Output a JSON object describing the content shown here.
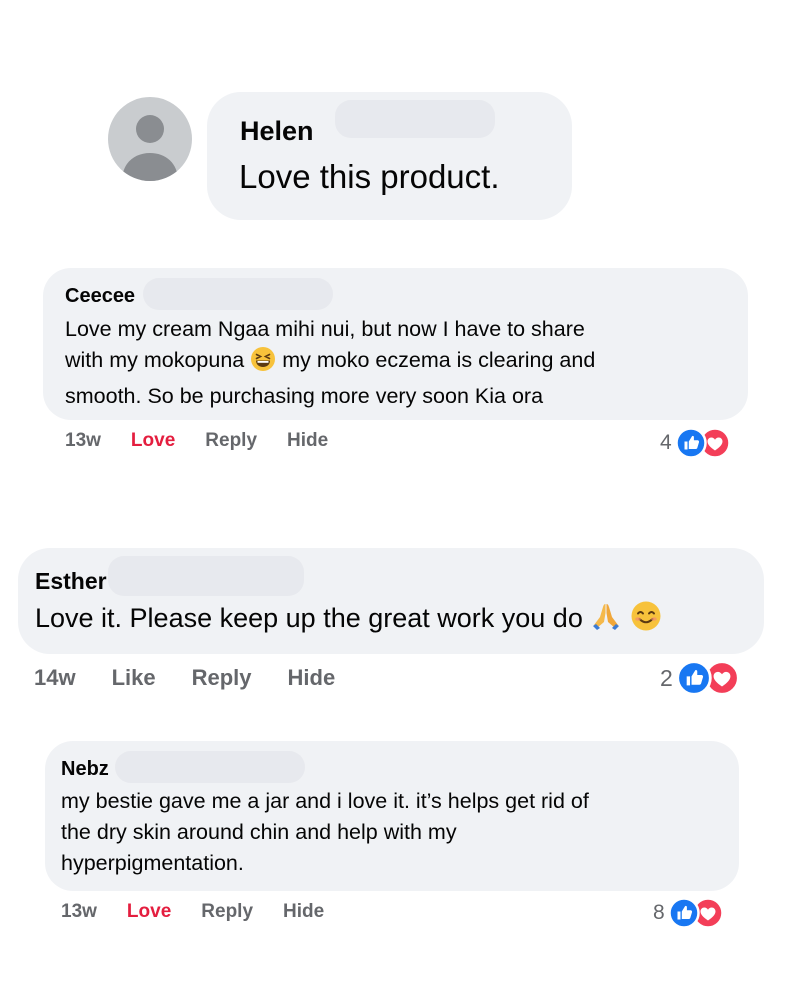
{
  "colors": {
    "bubble": "#f0f2f5",
    "love_action": "#e41e3f",
    "like_badge": "#1877f2",
    "heart_badge": "#f33e58",
    "meta_text": "#65676b"
  },
  "comments": [
    {
      "author": "Helen",
      "text": "Love this product.",
      "avatar": "default-avatar-icon"
    },
    {
      "author": "Ceecee",
      "text_lines": [
        "Love my cream Ngaa mihi nui, but now I have to share",
        "with my mokopuna",
        "my moko eczema is clearing and",
        "smooth. So be purchasing more very soon Kia ora"
      ],
      "emoji": "grinning-squinting-face-emoji",
      "time": "13w",
      "action_primary": "Love",
      "reply": "Reply",
      "hide": "Hide",
      "reaction_count": "4",
      "reactions": [
        "like-icon",
        "heart-icon"
      ]
    },
    {
      "author": "Esther",
      "text": "Love it. Please keep up the great work you do",
      "emojis": [
        "folded-hands-emoji",
        "smiling-face-emoji"
      ],
      "time": "14w",
      "action_primary": "Like",
      "reply": "Reply",
      "hide": "Hide",
      "reaction_count": "2",
      "reactions": [
        "like-icon",
        "heart-icon"
      ]
    },
    {
      "author": "Nebz",
      "text_lines": [
        "my bestie gave me a jar and i love it. it’s helps get rid of",
        "the dry skin around chin and help with my",
        "hyperpigmentation."
      ],
      "time": "13w",
      "action_primary": "Love",
      "reply": "Reply",
      "hide": "Hide",
      "reaction_count": "8",
      "reactions": [
        "like-icon",
        "heart-icon"
      ]
    }
  ]
}
